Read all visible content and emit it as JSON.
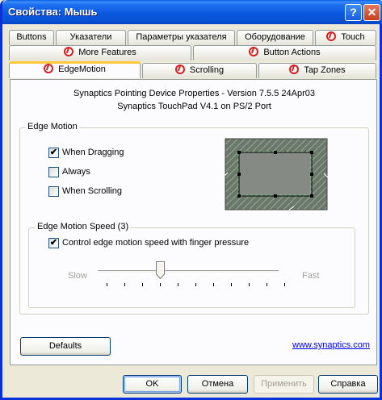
{
  "window": {
    "title": "Свойства: Мышь",
    "help_glyph": "?",
    "close_glyph": "✕"
  },
  "tabs_row1": [
    "Buttons",
    "Указатели",
    "Параметры указателя",
    "Оборудование",
    "Touch"
  ],
  "tabs_row2": [
    "More Features",
    "Button Actions"
  ],
  "tabs_row3": [
    "EdgeMotion",
    "Scrolling",
    "Tap Zones"
  ],
  "info": {
    "line1": "Synaptics Pointing Device Properties - Version 7.5.5 24Apr03",
    "line2": "Synaptics TouchPad V4.1 on PS/2 Port"
  },
  "edge_motion": {
    "group_label": "Edge Motion",
    "options": [
      {
        "label": "When Dragging",
        "checked": true
      },
      {
        "label": "Always",
        "checked": false
      },
      {
        "label": "When Scrolling",
        "checked": false
      }
    ]
  },
  "edge_speed": {
    "group_label": "Edge Motion Speed (3)",
    "pressure_label": "Control edge motion speed with finger pressure",
    "pressure_checked": true,
    "slow_label": "Slow",
    "fast_label": "Fast",
    "slider_value": 3,
    "slider_max": 10
  },
  "buttons": {
    "defaults": "Defaults",
    "ok": "OK",
    "cancel": "Отмена",
    "apply": "Применить",
    "help": "Справка"
  },
  "link": "www.synaptics.com"
}
